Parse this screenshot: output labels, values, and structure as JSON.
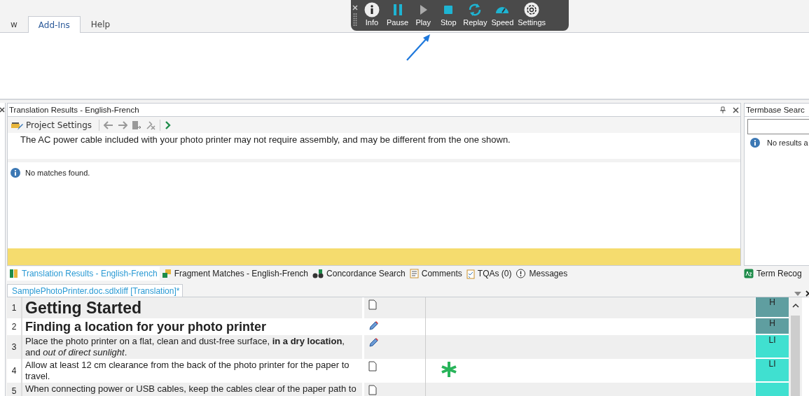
{
  "ribbon": {
    "tabs": [
      {
        "label": "w",
        "selected": false
      },
      {
        "label": "Add-Ins",
        "selected": true
      },
      {
        "label": "Help",
        "selected": false
      }
    ]
  },
  "player": {
    "buttons": [
      {
        "label": "Info",
        "kind": "info",
        "disabled": false
      },
      {
        "label": "Pause",
        "kind": "pause",
        "disabled": false
      },
      {
        "label": "Play",
        "kind": "play",
        "disabled": true
      },
      {
        "label": "Stop",
        "kind": "stop",
        "disabled": false
      },
      {
        "label": "Replay",
        "kind": "replay",
        "disabled": false
      },
      {
        "label": "Speed",
        "kind": "speed",
        "disabled": false
      },
      {
        "label": "Settings",
        "kind": "settings",
        "disabled": false
      }
    ]
  },
  "translation_results": {
    "title": "Translation Results - English-French",
    "toolbar_button": "Project Settings",
    "source": "The AC power cable included with your photo printer may not require assembly, and may be different from the one shown.",
    "message": "No matches found."
  },
  "termbase": {
    "title": "Termbase Searc",
    "message": "No results a"
  },
  "bottom_tabs": [
    {
      "label": "Translation Results - English-French",
      "kind": "results",
      "selected": true
    },
    {
      "label": "Fragment Matches - English-French",
      "kind": "fragment",
      "selected": false
    },
    {
      "label": "Concordance Search",
      "kind": "concordance",
      "selected": false
    },
    {
      "label": "Comments",
      "kind": "comments",
      "selected": false
    },
    {
      "label": "TQAs (0)",
      "kind": "tqa",
      "selected": false
    },
    {
      "label": "Messages",
      "kind": "messages",
      "selected": false
    }
  ],
  "side_tab": "Term Recog",
  "document": {
    "tab": "SamplePhotoPrinter.doc.sdlxliff [Translation]*",
    "rows": [
      {
        "number": "1",
        "source": "Getting Started",
        "edited": false,
        "asterisk": false,
        "match": "H",
        "color": "#5f9ea0"
      },
      {
        "number": "2",
        "source": "Finding a location for your photo printer",
        "edited": true,
        "asterisk": false,
        "match": "H",
        "color": "#5f9ea0"
      },
      {
        "number": "3",
        "source": "Place the photo printer on a flat, clean and dust-free surface, **in a dry location**, and *out of direct sunlight*.",
        "edited": true,
        "asterisk": false,
        "match": "LI",
        "color": "#40e0d0"
      },
      {
        "number": "4",
        "source": "Allow at least 12 cm clearance from the back of the photo printer for the paper to travel.",
        "edited": false,
        "asterisk": true,
        "match": "LI",
        "color": "#40e0d0"
      },
      {
        "number": "5",
        "source": "When connecting power or USB cables, keep the cables clear of the paper path to",
        "edited": false,
        "asterisk": false,
        "color": "#40e0d0"
      }
    ]
  }
}
